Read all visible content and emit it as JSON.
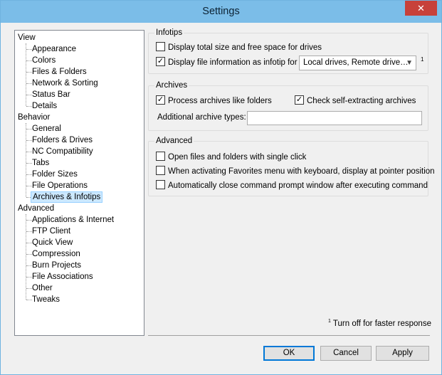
{
  "window": {
    "title": "Settings",
    "close_label": "✕"
  },
  "tree": {
    "view": {
      "label": "View",
      "children": [
        "Appearance",
        "Colors",
        "Files & Folders",
        "Network & Sorting",
        "Status Bar",
        "Details"
      ]
    },
    "behavior": {
      "label": "Behavior",
      "children": [
        "General",
        "Folders & Drives",
        "NC Compatibility",
        "Tabs",
        "Folder Sizes",
        "File Operations",
        "Archives & Infotips"
      ]
    },
    "advanced": {
      "label": "Advanced",
      "children": [
        "Applications & Internet",
        "FTP Client",
        "Quick View",
        "Compression",
        "Burn Projects",
        "File Associations",
        "Other",
        "Tweaks"
      ]
    },
    "selected": "Archives & Infotips"
  },
  "infotips": {
    "title": "Infotips",
    "total_size": {
      "label": "Display total size and free space for drives",
      "checked": false
    },
    "file_info": {
      "label": "Display file information as infotip for",
      "checked": true
    },
    "drives_select": {
      "value": "Local drives, Remote drive…"
    },
    "footnote_mark": "1"
  },
  "archives": {
    "title": "Archives",
    "process": {
      "label": "Process archives like folders",
      "checked": true
    },
    "self_extract": {
      "label": "Check self-extracting archives",
      "checked": true
    },
    "additional_label": "Additional archive types:",
    "additional_value": ""
  },
  "advanced": {
    "title": "Advanced",
    "single_click": {
      "label": "Open files and folders with single click",
      "checked": false
    },
    "favorites": {
      "label": "When activating Favorites menu with keyboard, display at pointer position",
      "checked": false
    },
    "close_prompt": {
      "label": "Automatically close command prompt window after executing command",
      "checked": false
    }
  },
  "footnote": {
    "mark": "1",
    "text": "Turn off for faster response"
  },
  "buttons": {
    "ok": "OK",
    "cancel": "Cancel",
    "apply": "Apply"
  }
}
